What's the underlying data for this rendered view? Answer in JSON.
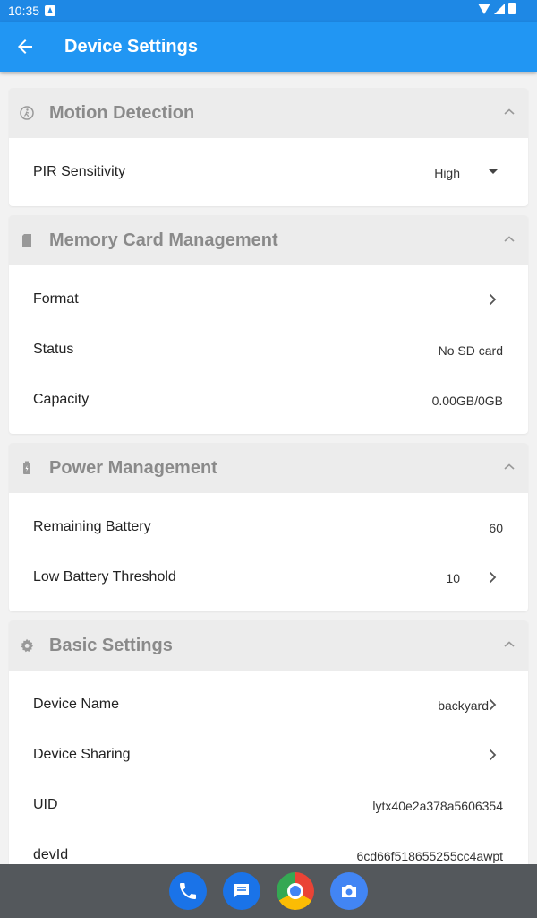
{
  "status_bar": {
    "time": "10:35"
  },
  "app_bar": {
    "title": "Device Settings"
  },
  "sections": {
    "motion": {
      "title": "Motion Detection",
      "pir_label": "PIR Sensitivity",
      "pir_value": "High"
    },
    "memory": {
      "title": "Memory Card Management",
      "format_label": "Format",
      "status_label": "Status",
      "status_value": "No SD card",
      "capacity_label": "Capacity",
      "capacity_value": "0.00GB/0GB"
    },
    "power": {
      "title": "Power Management",
      "remaining_label": "Remaining Battery",
      "remaining_value": "60",
      "threshold_label": "Low Battery Threshold",
      "threshold_value": "10"
    },
    "basic": {
      "title": "Basic Settings",
      "name_label": "Device Name",
      "name_value": "backyard",
      "sharing_label": "Device Sharing",
      "uid_label": "UID",
      "uid_value": "lytx40e2a378a5606354",
      "devid_label": "devId",
      "devid_value": "6cd66f518655255cc4awpt"
    }
  },
  "dock": [
    "phone-icon",
    "messages-icon",
    "chrome-icon",
    "camera-icon"
  ],
  "colors": {
    "status_bar": "#1e88e5",
    "app_bar": "#2196f3",
    "header_text": "#8a8a8a",
    "nav_bar": "#54585c"
  }
}
